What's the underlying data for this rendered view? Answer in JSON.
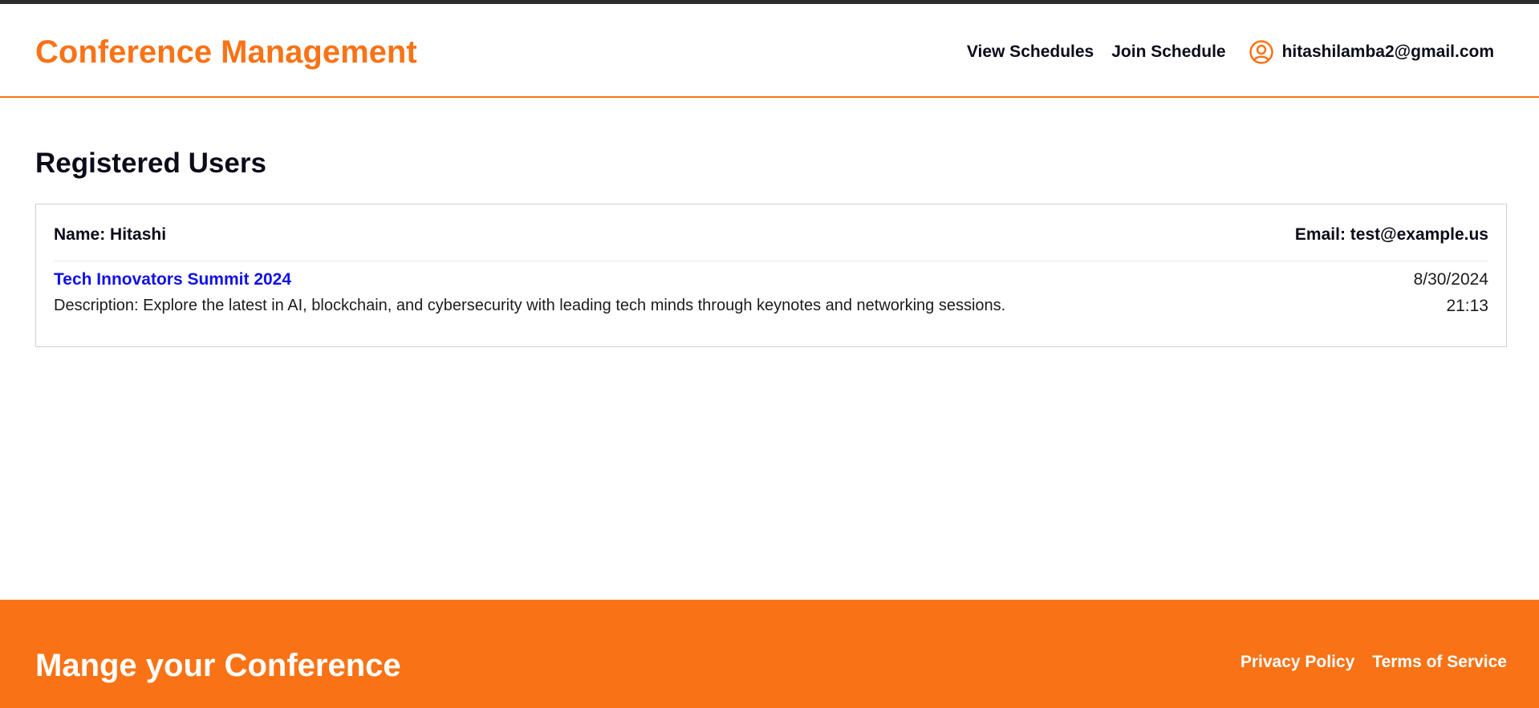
{
  "header": {
    "brand": "Conference Management",
    "nav": {
      "view_schedules": "View Schedules",
      "join_schedule": "Join Schedule"
    },
    "user": {
      "icon": "user-circle-icon",
      "email": "hitashilamba2@gmail.com"
    }
  },
  "main": {
    "title": "Registered Users",
    "users": [
      {
        "name_label": "Name: Hitashi",
        "email_label": "Email: test@example.us",
        "events": [
          {
            "title": "Tech Innovators Summit 2024",
            "description": "Description: Explore the latest in AI, blockchain, and cybersecurity with leading tech minds through keynotes and networking sessions.",
            "date": "8/30/2024",
            "time": "21:13"
          }
        ]
      }
    ]
  },
  "footer": {
    "title": "Mange your Conference",
    "links": {
      "privacy": "Privacy Policy",
      "terms": "Terms of Service"
    }
  },
  "colors": {
    "accent": "#f97316",
    "link": "#1010e8",
    "text": "#0b0b1a"
  }
}
